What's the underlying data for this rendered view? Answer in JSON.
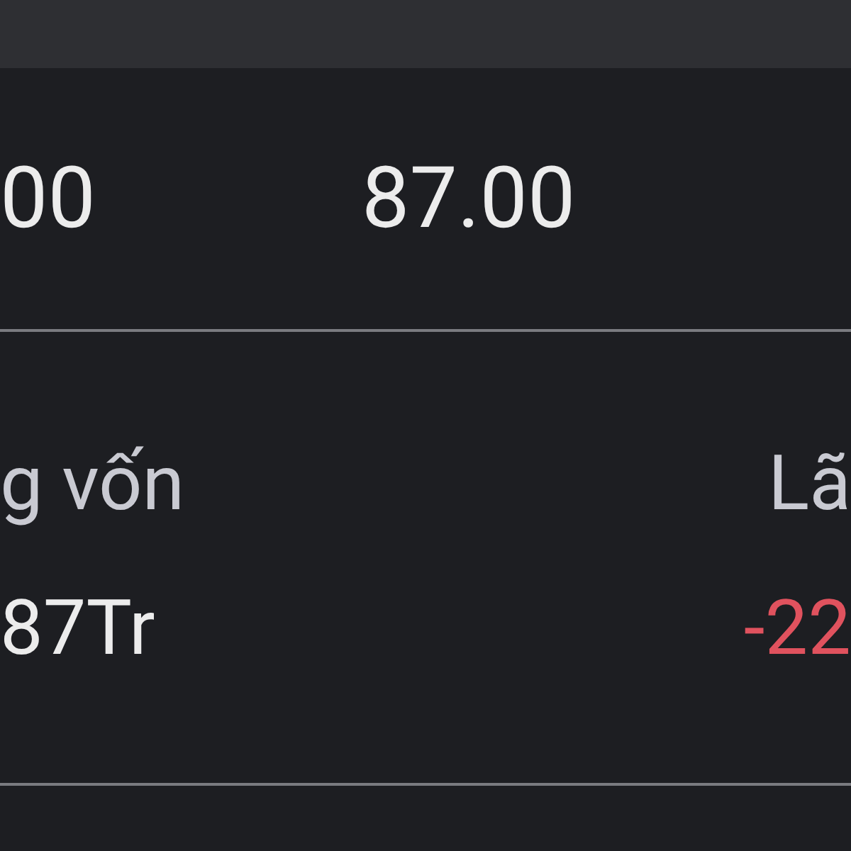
{
  "price_row": {
    "column_1": "00",
    "column_2": "87.00"
  },
  "summary": {
    "labels": [
      "g vốn",
      "Lã"
    ],
    "values": [
      {
        "text": "87Tr",
        "kind": "neutral"
      },
      {
        "text": "-22",
        "kind": "loss"
      }
    ]
  }
}
